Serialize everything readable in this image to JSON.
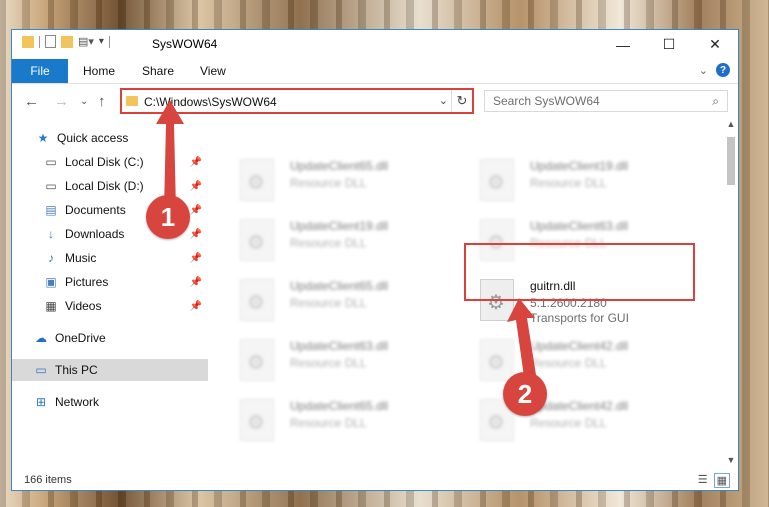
{
  "window": {
    "title": "SysWOW64"
  },
  "ribbon": {
    "file": "File",
    "tabs": [
      "Home",
      "Share",
      "View"
    ],
    "help_label": "?"
  },
  "address": {
    "path": "C:\\Windows\\SysWOW64"
  },
  "search": {
    "placeholder": "Search SysWOW64"
  },
  "nav": {
    "items": [
      {
        "label": "Quick access",
        "icon": "star-icon"
      },
      {
        "label": "Local Disk (C:)",
        "icon": "drive-icon"
      },
      {
        "label": "Local Disk (D:)",
        "icon": "drive-icon"
      },
      {
        "label": "Documents",
        "icon": "documents-icon"
      },
      {
        "label": "Downloads",
        "icon": "download-icon"
      },
      {
        "label": "Music",
        "icon": "music-icon"
      },
      {
        "label": "Pictures",
        "icon": "pictures-icon"
      },
      {
        "label": "Videos",
        "icon": "videos-icon"
      },
      {
        "label": "OneDrive",
        "icon": "cloud-icon"
      },
      {
        "label": "This PC",
        "icon": "computer-icon"
      },
      {
        "label": "Network",
        "icon": "network-icon"
      }
    ]
  },
  "files": [
    {
      "name": "UpdateClient65.dll",
      "desc": "Resource DLL",
      "blurred": true
    },
    {
      "name": "UpdateClient19.dll",
      "desc": "Resource DLL",
      "blurred": true
    },
    {
      "name": "UpdateClient19.dll",
      "desc": "Resource DLL",
      "blurred": true
    },
    {
      "name": "UpdateClient63.dll",
      "desc": "Resource DLL",
      "blurred": true
    },
    {
      "name": "UpdateClient65.dll",
      "desc": "Resource DLL",
      "blurred": true
    },
    {
      "name": "guitrn.dll",
      "version": "5.1.2600.2180",
      "desc": "Transports for GUI",
      "blurred": false
    },
    {
      "name": "UpdateClient63.dll",
      "desc": "Resource DLL",
      "blurred": true
    },
    {
      "name": "UpdateClient42.dll",
      "desc": "Resource DLL",
      "blurred": true
    },
    {
      "name": "UpdateClient65.dll",
      "desc": "Resource DLL",
      "blurred": true
    },
    {
      "name": "UpdateClient42.dll",
      "desc": "Resource DLL",
      "blurred": true
    }
  ],
  "status": {
    "count": "166 items"
  },
  "annotations": {
    "badge1": "1",
    "badge2": "2",
    "color": "#d8453f"
  }
}
